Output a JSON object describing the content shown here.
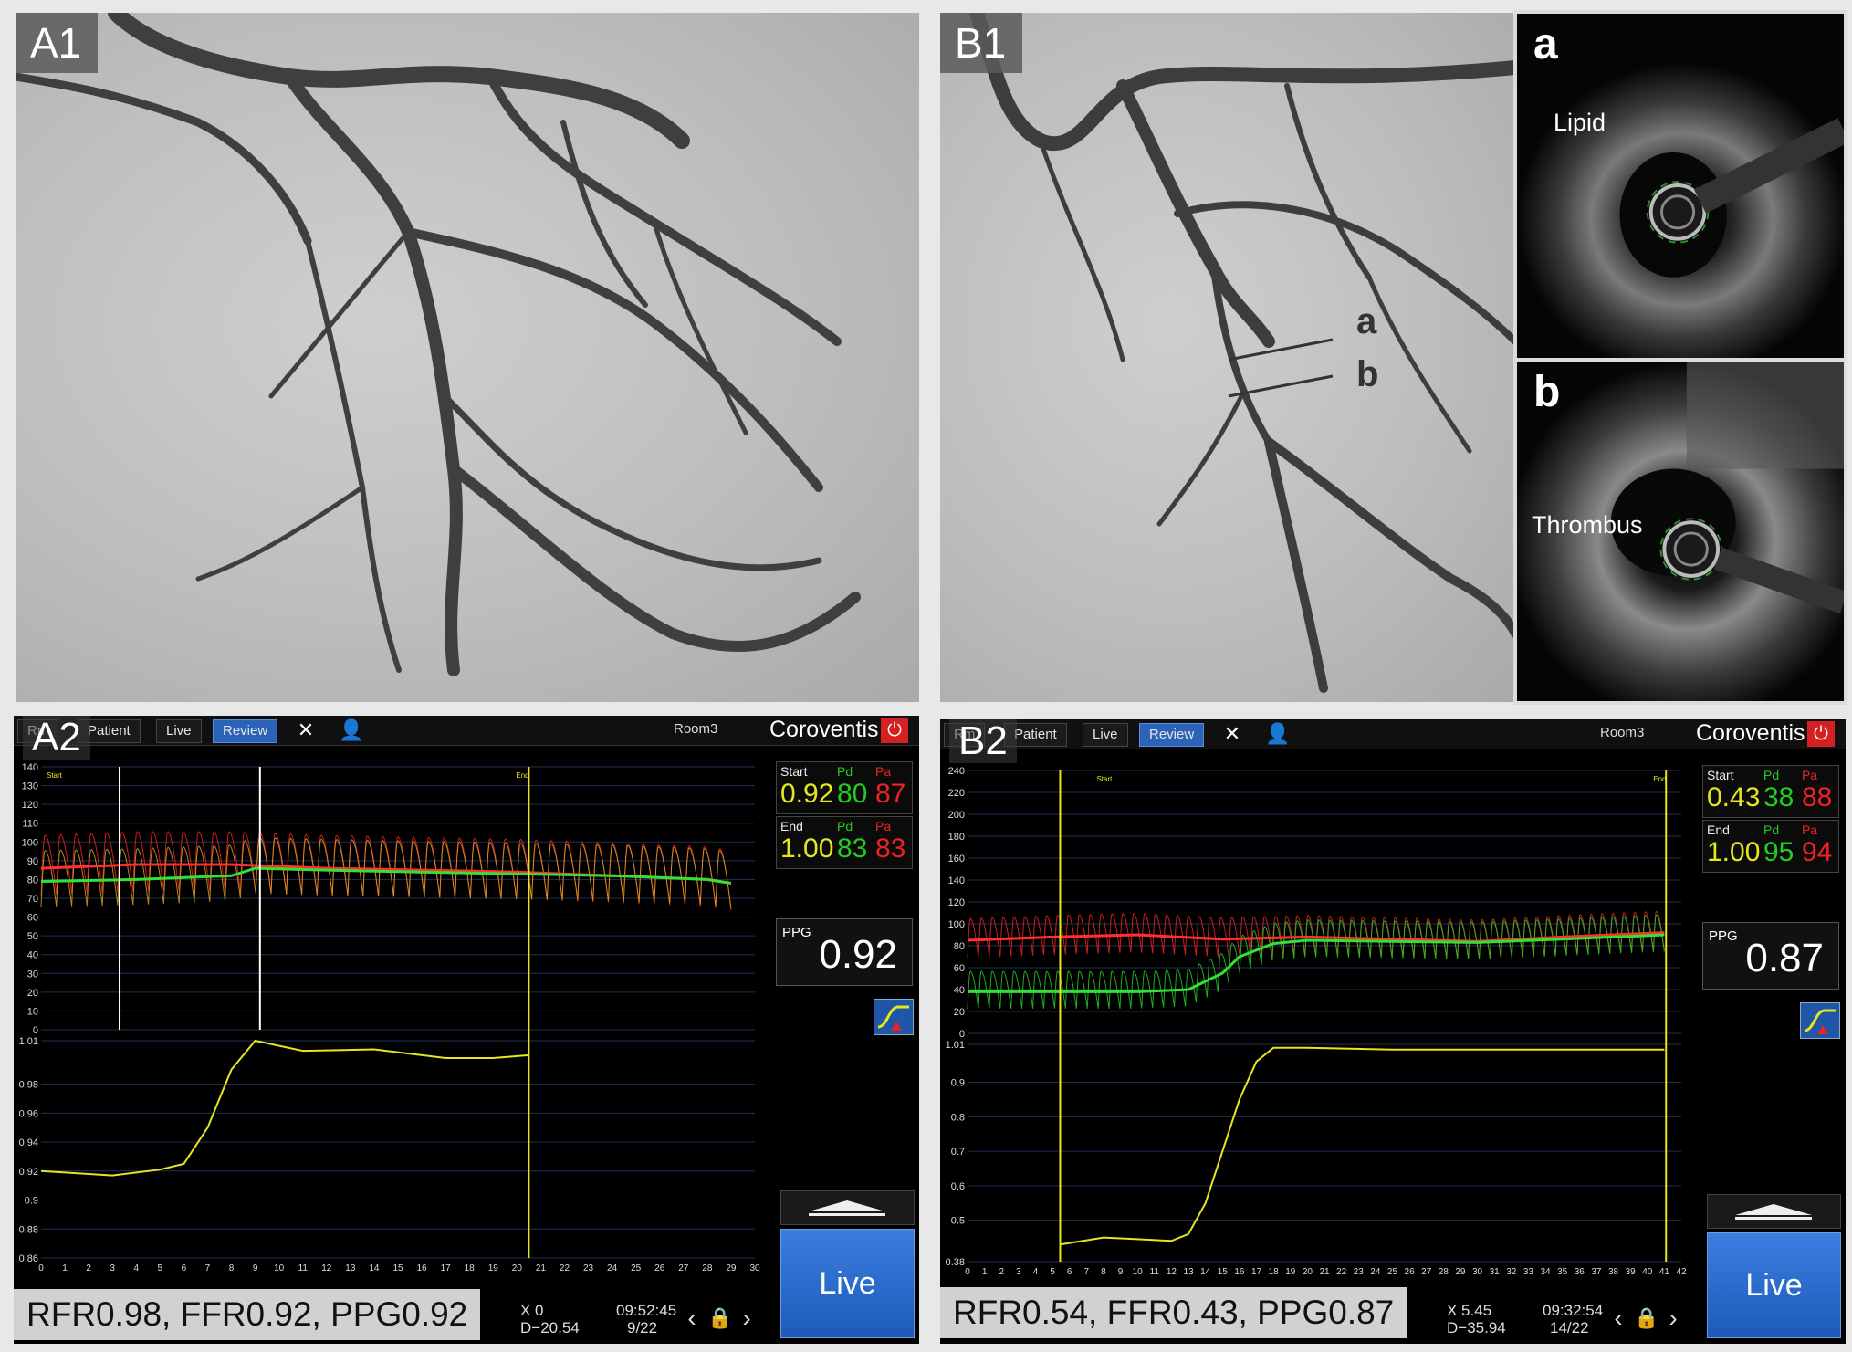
{
  "panels": {
    "a1": {
      "label": "A1"
    },
    "b1": {
      "label": "B1"
    },
    "segments": {
      "a": "a",
      "b": "b"
    },
    "oct_a": {
      "letter": "a",
      "tag": "Lipid"
    },
    "oct_b": {
      "letter": "b",
      "tag": "Thrombus"
    }
  },
  "colors": {
    "pd": "#22cc22",
    "pa": "#ee2222",
    "ratio": "#e6e61e",
    "accent": "#2b63b8",
    "brand_red": "#d42020"
  },
  "monitors": [
    {
      "label": "A2",
      "topbar": {
        "tab_hidden": "Rm",
        "tab_patient": "Patient",
        "tab_live": "Live",
        "tab_review": "Review",
        "tools_icon": "wrench-icon",
        "user_icon": "user-icon",
        "room": "Room3",
        "brand": "Coroventis",
        "power_icon": "power-icon"
      },
      "start": {
        "label": "Start",
        "pd_label": "Pd",
        "pa_label": "Pa",
        "ratio": "0.92",
        "pd": "80",
        "pa": "87"
      },
      "end": {
        "label": "End",
        "pd_label": "Pd",
        "pa_label": "Pa",
        "ratio": "1.00",
        "pd": "83",
        "pa": "83"
      },
      "ppg": {
        "label": "PPG",
        "value": "0.92"
      },
      "live_button": "Live",
      "readout": "RFR0.98, FFR0.92, PPG0.92",
      "x_value": "X 0",
      "d_value": "D−20.54",
      "time": "09:52:45",
      "index": "9/22",
      "marker_start": "Start",
      "marker_end": "End"
    },
    {
      "label": "B2",
      "topbar": {
        "tab_hidden": "Rm",
        "tab_patient": "Patient",
        "tab_live": "Live",
        "tab_review": "Review",
        "tools_icon": "wrench-icon",
        "user_icon": "user-icon",
        "room": "Room3",
        "brand": "Coroventis",
        "power_icon": "power-icon"
      },
      "start": {
        "label": "Start",
        "pd_label": "Pd",
        "pa_label": "Pa",
        "ratio": "0.43",
        "pd": "38",
        "pa": "88"
      },
      "end": {
        "label": "End",
        "pd_label": "Pd",
        "pa_label": "Pa",
        "ratio": "1.00",
        "pd": "95",
        "pa": "94"
      },
      "ppg": {
        "label": "PPG",
        "value": "0.87"
      },
      "live_button": "Live",
      "readout": "RFR0.54, FFR0.43, PPG0.87",
      "x_value": "X 5.45",
      "d_value": "D−35.94",
      "time": "09:32:54",
      "index": "14/22",
      "marker_start": "Start",
      "marker_end": "End"
    }
  ],
  "chart_data": [
    {
      "type": "line",
      "title": "",
      "pressure_axis": {
        "ylim": [
          0,
          140
        ],
        "ticks": [
          0,
          10,
          20,
          30,
          40,
          50,
          60,
          70,
          80,
          90,
          100,
          110,
          120,
          130,
          140
        ]
      },
      "ratio_axis": {
        "ylim": [
          0.86,
          1.01
        ],
        "ticks": [
          0.86,
          0.88,
          0.9,
          0.92,
          0.94,
          0.96,
          0.98,
          1.01
        ]
      },
      "x_ticks": [
        0,
        1,
        2,
        3,
        4,
        5,
        6,
        7,
        8,
        9,
        10,
        11,
        12,
        13,
        14,
        15,
        16,
        17,
        18,
        19,
        20,
        21,
        22,
        23,
        24,
        25,
        26,
        27,
        28,
        29,
        30
      ],
      "xlim": [
        0,
        30
      ],
      "markers_x": [
        3.3,
        9.2
      ],
      "pullback_end_x": 20.5,
      "series": [
        {
          "name": "Pa",
          "values": [
            [
              0,
              86
            ],
            [
              4,
              88
            ],
            [
              8,
              88
            ],
            [
              12,
              86
            ],
            [
              16,
              85
            ],
            [
              20,
              84
            ],
            [
              24,
              82
            ],
            [
              28,
              80
            ],
            [
              29,
              78
            ]
          ]
        },
        {
          "name": "Pd",
          "values": [
            [
              0,
              79
            ],
            [
              4,
              80
            ],
            [
              8,
              82
            ],
            [
              9,
              86
            ],
            [
              12,
              85
            ],
            [
              16,
              84
            ],
            [
              20,
              83
            ],
            [
              24,
              82
            ],
            [
              28,
              80
            ],
            [
              29,
              78
            ]
          ]
        },
        {
          "name": "Pd/Pa",
          "values": [
            [
              0,
              0.92
            ],
            [
              3,
              0.917
            ],
            [
              5,
              0.921
            ],
            [
              6,
              0.925
            ],
            [
              7,
              0.95
            ],
            [
              8,
              0.99
            ],
            [
              9,
              1.01
            ],
            [
              11,
              1.003
            ],
            [
              14,
              1.004
            ],
            [
              17,
              0.998
            ],
            [
              19,
              0.998
            ],
            [
              20.5,
              1.0
            ]
          ]
        }
      ]
    },
    {
      "type": "line",
      "title": "",
      "pressure_axis": {
        "ylim": [
          0,
          240
        ],
        "ticks": [
          0,
          20,
          40,
          60,
          80,
          100,
          120,
          140,
          160,
          180,
          200,
          220,
          240
        ]
      },
      "ratio_axis": {
        "ylim": [
          0.38,
          1.01
        ],
        "ticks": [
          0.38,
          0.5,
          0.6,
          0.7,
          0.8,
          0.9,
          1.01
        ]
      },
      "x_ticks": [
        0,
        1,
        2,
        3,
        4,
        5,
        6,
        7,
        8,
        9,
        10,
        11,
        12,
        13,
        14,
        15,
        16,
        17,
        18,
        19,
        20,
        21,
        22,
        23,
        24,
        25,
        26,
        27,
        28,
        29,
        30,
        31,
        32,
        33,
        34,
        35,
        36,
        37,
        38,
        39,
        40,
        41,
        42
      ],
      "xlim": [
        0,
        42
      ],
      "markers_x": [],
      "pullback_start_x": 5.45,
      "pullback_end_x": 41.1,
      "series": [
        {
          "name": "Pa",
          "values": [
            [
              0,
              85
            ],
            [
              5,
              88
            ],
            [
              10,
              90
            ],
            [
              15,
              86
            ],
            [
              20,
              88
            ],
            [
              25,
              86
            ],
            [
              30,
              84
            ],
            [
              35,
              88
            ],
            [
              41,
              92
            ]
          ]
        },
        {
          "name": "Pd",
          "values": [
            [
              0,
              38
            ],
            [
              5,
              38
            ],
            [
              10,
              38
            ],
            [
              13,
              40
            ],
            [
              15,
              55
            ],
            [
              16,
              70
            ],
            [
              18,
              82
            ],
            [
              20,
              85
            ],
            [
              25,
              84
            ],
            [
              30,
              83
            ],
            [
              35,
              86
            ],
            [
              41,
              90
            ]
          ]
        },
        {
          "name": "Pd/Pa",
          "values": [
            [
              5.5,
              0.43
            ],
            [
              8,
              0.45
            ],
            [
              10,
              0.445
            ],
            [
              12,
              0.44
            ],
            [
              13,
              0.46
            ],
            [
              14,
              0.55
            ],
            [
              15,
              0.7
            ],
            [
              16,
              0.85
            ],
            [
              17,
              0.96
            ],
            [
              18,
              1.0
            ],
            [
              20,
              1.0
            ],
            [
              25,
              0.995
            ],
            [
              30,
              0.995
            ],
            [
              35,
              0.995
            ],
            [
              41,
              0.995
            ]
          ]
        }
      ]
    }
  ]
}
